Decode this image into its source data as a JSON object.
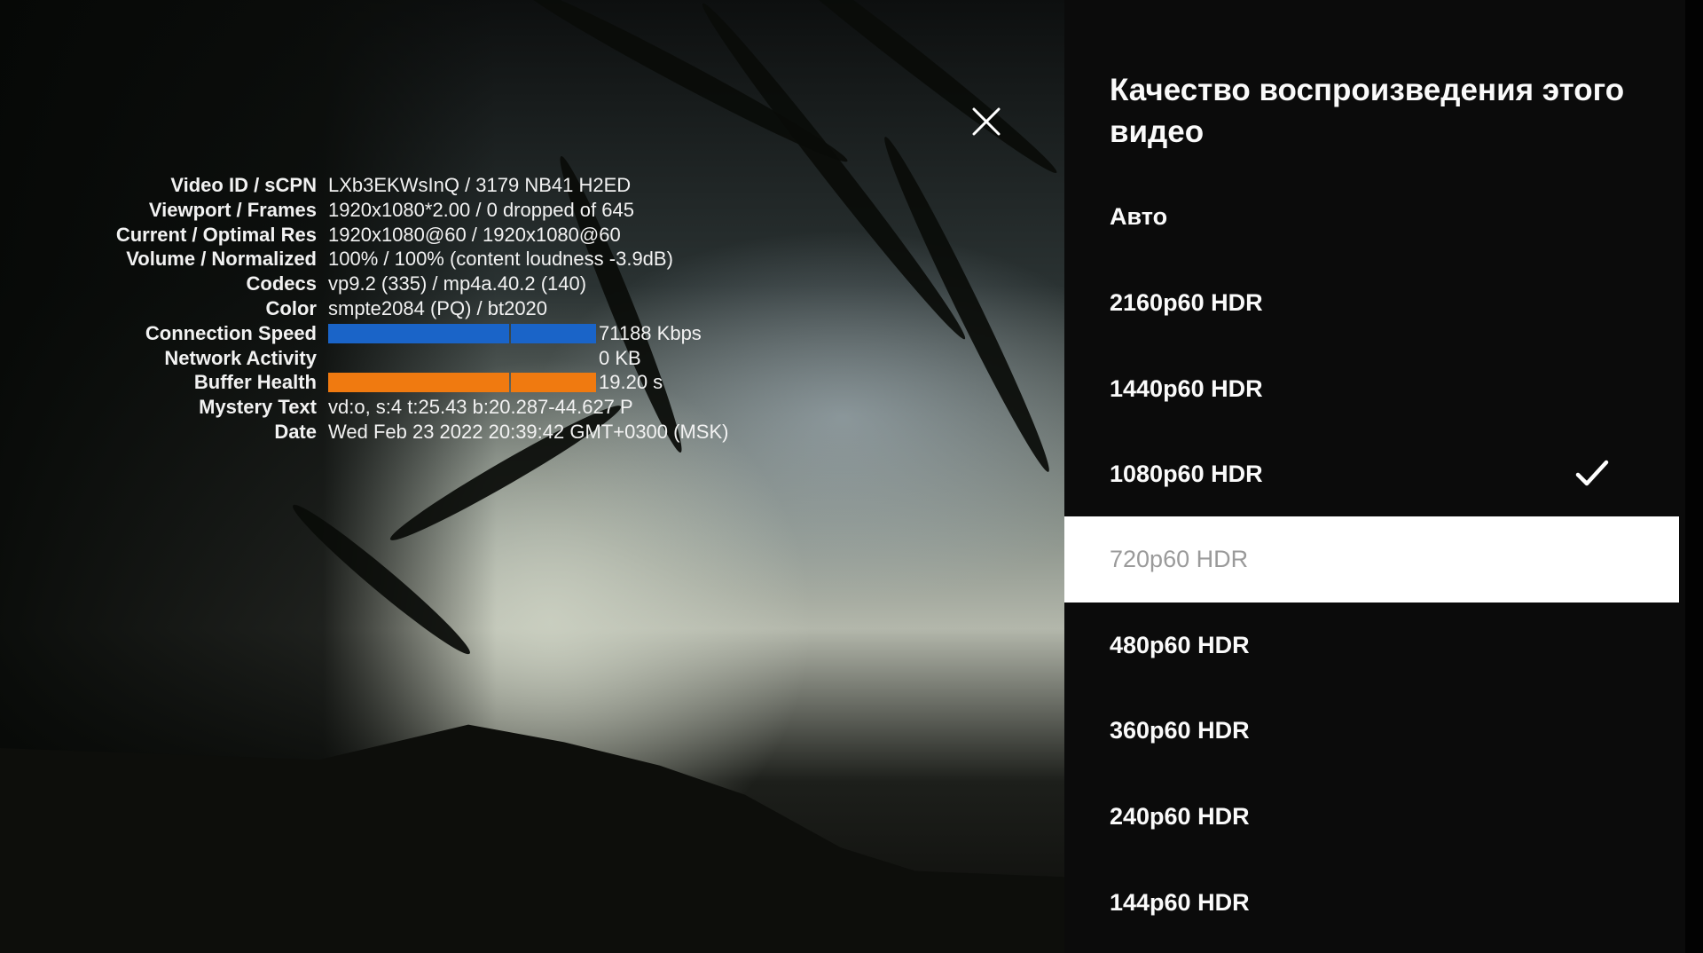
{
  "stats": {
    "rows": [
      {
        "key": "Video ID / sCPN",
        "value": "LXb3EKWsInQ / 3179 NB41 H2ED"
      },
      {
        "key": "Viewport / Frames",
        "value": "1920x1080*2.00 / 0 dropped of 645"
      },
      {
        "key": "Current / Optimal Res",
        "value": "1920x1080@60 / 1920x1080@60"
      },
      {
        "key": "Volume / Normalized",
        "value": "100% / 100% (content loudness -3.9dB)"
      },
      {
        "key": "Codecs",
        "value": "vp9.2 (335) / mp4a.40.2 (140)"
      },
      {
        "key": "Color",
        "value": "smpte2084 (PQ) / bt2020"
      },
      {
        "key": "Connection Speed",
        "value": "71188 Kbps"
      },
      {
        "key": "Network Activity",
        "value": "0 KB"
      },
      {
        "key": "Buffer Health",
        "value": "19.20 s"
      },
      {
        "key": "Mystery Text",
        "value": "vd:o, s:4 t:25.43 b:20.287-44.627 P"
      },
      {
        "key": "Date",
        "value": "Wed Feb 23 2022 20:39:42 GMT+0300 (MSK)"
      }
    ],
    "connection_speed_bar": {
      "color": "#1a64c8",
      "fill": 1.0
    },
    "buffer_health_bar": {
      "color": "#f07a10",
      "fill": 1.0
    }
  },
  "close_icon": "close-icon",
  "quality_menu": {
    "title": "Качество воспроизведения этого видео",
    "items": [
      {
        "label": "Авто",
        "checked": false,
        "focused": false
      },
      {
        "label": "2160p60 HDR",
        "checked": false,
        "focused": false
      },
      {
        "label": "1440p60 HDR",
        "checked": false,
        "focused": false
      },
      {
        "label": "1080p60 HDR",
        "checked": true,
        "focused": false
      },
      {
        "label": "720p60 HDR",
        "checked": false,
        "focused": true
      },
      {
        "label": "480p60 HDR",
        "checked": false,
        "focused": false
      },
      {
        "label": "360p60 HDR",
        "checked": false,
        "focused": false
      },
      {
        "label": "240p60 HDR",
        "checked": false,
        "focused": false
      },
      {
        "label": "144p60 HDR",
        "checked": false,
        "focused": false
      }
    ],
    "check_icon": "checkmark-icon"
  }
}
